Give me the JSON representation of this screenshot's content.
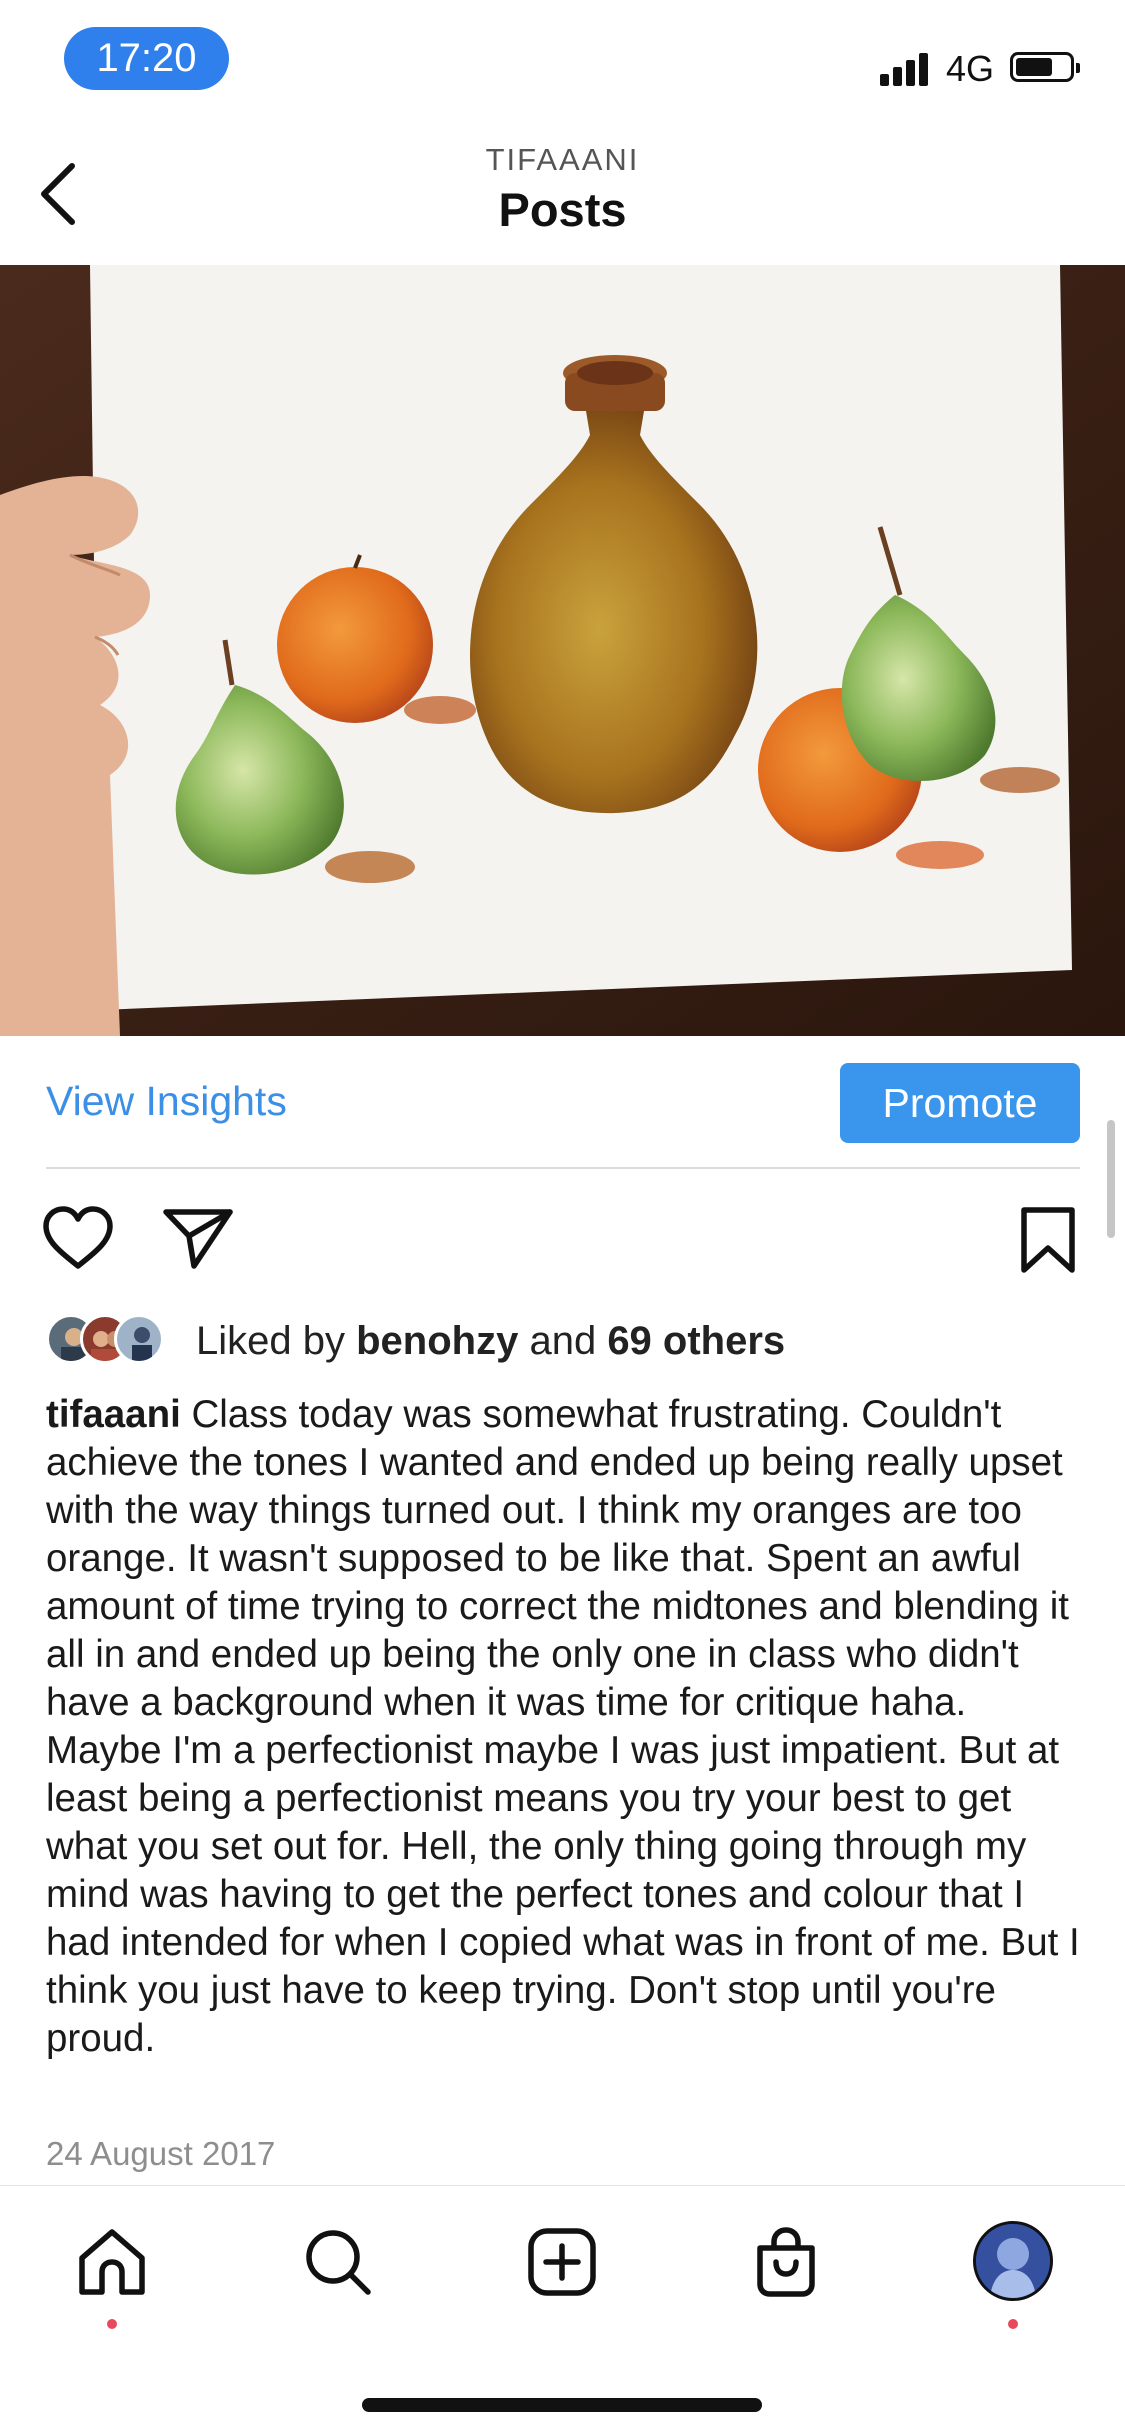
{
  "status_bar": {
    "time": "17:20",
    "network": "4G"
  },
  "header": {
    "account": "TIFAAANI",
    "title": "Posts",
    "back_icon": "chevron-left-icon"
  },
  "post": {
    "image_description_icon": "watercolor-still-life-image",
    "insights_label": "View Insights",
    "promote_label": "Promote",
    "actions": [
      "heart-icon",
      "send-icon",
      "bookmark-icon"
    ],
    "likes": {
      "prefix": "Liked by ",
      "user": "benohzy",
      "middle": " and ",
      "others": "69 others"
    },
    "caption": {
      "username": "tifaaani",
      "text": " Class today was somewhat frustrating. Couldn't achieve the tones I wanted and ended up being really upset with the way things turned out. I think my oranges are too orange. It wasn't supposed to be like that. Spent an awful amount of time trying to correct the midtones and blending it all in and ended up being the only one in class who didn't have a background when it was time for critique haha. Maybe I'm a perfectionist maybe I was just impatient. But at least being a perfectionist means you try your best to get what you set out for. Hell, the only thing going through my mind was having to get the perfect tones and colour that I had intended for when I copied what was in front of me. But I think you just have to keep trying. Don't stop until you're proud."
    },
    "date": "24 August 2017"
  },
  "bottom_nav": {
    "items": [
      "home-icon",
      "search-icon",
      "create-post-icon",
      "shop-icon",
      "profile-avatar"
    ]
  },
  "colors": {
    "accent": "#3a95ed",
    "link": "#3c8fe6",
    "time_pill": "#2f80ed",
    "notification_dot": "#e8495c"
  }
}
